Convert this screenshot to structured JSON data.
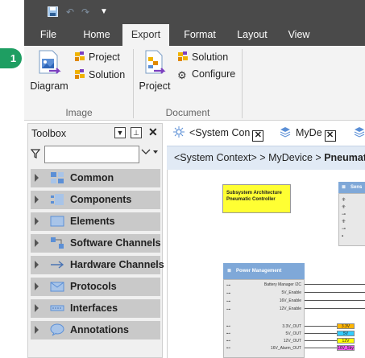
{
  "quick_access": {
    "icons": [
      "save-icon",
      "undo-icon",
      "redo-icon",
      "customize-icon"
    ]
  },
  "ribbon_tabs": [
    "File",
    "Home",
    "Export",
    "Format",
    "Layout",
    "View"
  ],
  "ribbon_active_tab": "Export",
  "step_badge": "1",
  "ribbon": {
    "image_group": {
      "label": "Image",
      "diagram_label": "Diagram",
      "project_label": "Project",
      "solution_label": "Solution"
    },
    "document_group": {
      "label": "Document",
      "project_label": "Project",
      "solution_label": "Solution",
      "configure_label": "Configure"
    }
  },
  "toolbox": {
    "title": "Toolbox",
    "search_value": "",
    "categories": [
      "Common",
      "Components",
      "Elements",
      "Software Channels",
      "Hardware Channels",
      "Protocols",
      "Interfaces",
      "Annotations"
    ]
  },
  "doc_tabs": [
    "<System Con",
    "MyDe"
  ],
  "breadcrumb": {
    "prefix": "<System Context> > MyDevice > ",
    "current": "Pneumat"
  },
  "canvas": {
    "note_text": "Subsystem Architecture Pneumatic Controller",
    "sensor_block_title": "Sens",
    "power_block_title": "Power Management",
    "power_inputs": [
      "Battery Manager I2C",
      "5V_Enable",
      "16V_Enable",
      "12V_Enable"
    ],
    "power_outputs": [
      "3.3V_OUT",
      "5V_OUT",
      "12V_OUT",
      "16V_Alarm_OUT"
    ],
    "power_tags": [
      "3.3V",
      "5V",
      "12V",
      "16V_5by"
    ],
    "tag_colors": [
      "#ffb400",
      "#33ccff",
      "#ffff00",
      "#ee55ee"
    ],
    "accent": "#7fa8d8"
  }
}
